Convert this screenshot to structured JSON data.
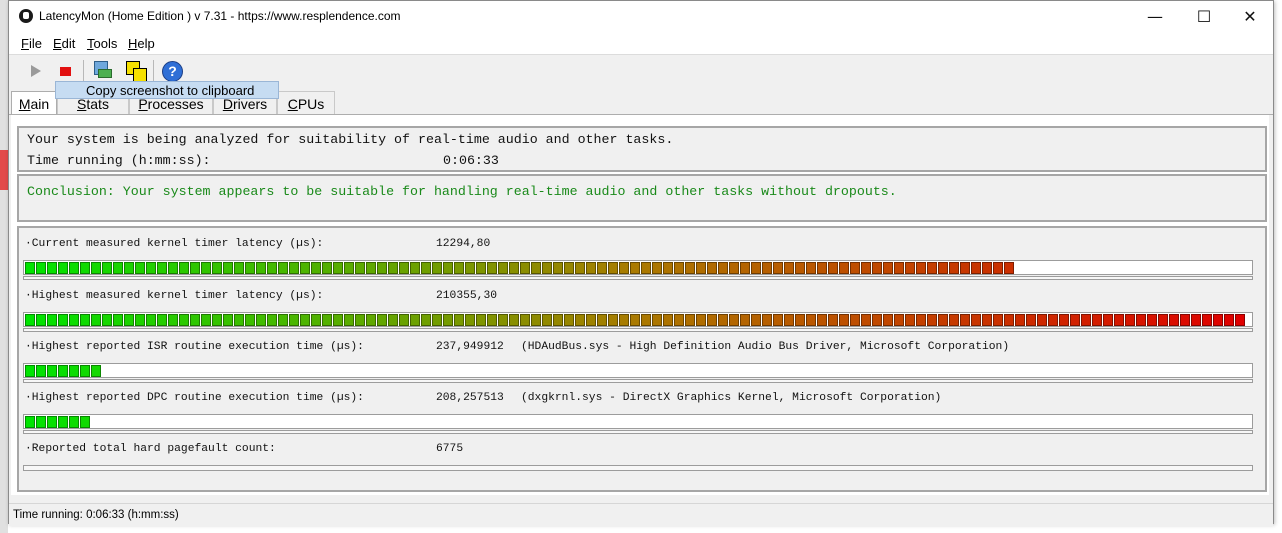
{
  "window": {
    "title": "LatencyMon  (Home Edition )  v 7.31 - https://www.resplendence.com",
    "controls": {
      "minimize": "—",
      "maximize": "☐",
      "close": "✕"
    }
  },
  "menu": [
    {
      "mnemonic": "F",
      "rest": "ile"
    },
    {
      "mnemonic": "E",
      "rest": "dit"
    },
    {
      "mnemonic": "T",
      "rest": "ools"
    },
    {
      "mnemonic": "H",
      "rest": "elp"
    }
  ],
  "toolbar": {
    "buttons": [
      "play-icon",
      "stop-icon",
      "drivers-icon",
      "copy-screenshot-icon",
      "help-icon"
    ],
    "help_glyph": "?",
    "tooltip": "Copy screenshot to clipboard"
  },
  "tabs": [
    {
      "mnemonic": "M",
      "rest": "ain",
      "active": true
    },
    {
      "mnemonic": "S",
      "rest": "tats",
      "active": false
    },
    {
      "mnemonic": "P",
      "rest": "rocesses",
      "active": false
    },
    {
      "mnemonic": "D",
      "rest": "rivers",
      "active": false
    },
    {
      "mnemonic": "C",
      "rest": "PUs",
      "active": false
    }
  ],
  "analysis": {
    "message": "Your system is being analyzed for suitability of real-time audio and other tasks.",
    "time_label": "Time running (h:mm:ss):",
    "time_value": "0:06:33"
  },
  "conclusion": {
    "text": "Conclusion: Your system appears to be suitable for handling real-time audio and other tasks without dropouts.",
    "color": "#1a8a1a"
  },
  "metrics": [
    {
      "label": "·Current measured kernel timer latency (µs):",
      "value": "12294,80",
      "detail": "",
      "fill": 0.812
    },
    {
      "label": "·Highest measured kernel timer latency (µs):",
      "value": "210355,30",
      "detail": "",
      "fill": 1.0
    },
    {
      "label": "·Highest reported ISR routine execution time (µs):",
      "value": "237,949912",
      "detail": "(HDAudBus.sys - High Definition Audio Bus Driver, Microsoft Corporation)",
      "fill": 0.065
    },
    {
      "label": "·Highest reported DPC routine execution time (µs):",
      "value": "208,257513",
      "detail": "(dxgkrnl.sys - DirectX Graphics Kernel, Microsoft Corporation)",
      "fill": 0.057
    },
    {
      "label": "·Reported total hard pagefault count:",
      "value": "6775",
      "detail": "",
      "fill": 0
    }
  ],
  "status": "Time running: 0:06:33  (h:mm:ss)",
  "colors": {
    "bar_low": "#00e400",
    "bar_mid": "#aa7a00",
    "bar_high": "#e00000"
  }
}
